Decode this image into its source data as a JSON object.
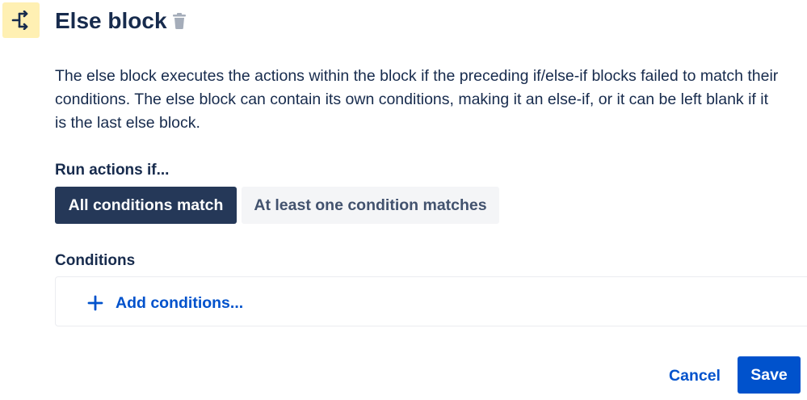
{
  "header": {
    "icon": "branch-icon",
    "title": "Else block",
    "delete_icon": "trash-icon"
  },
  "description": "The else block executes the actions within the block if the preceding if/else-if blocks failed to match their conditions. The else block can contain its own conditions, making it an else-if, or it can be left blank if it is the last else block.",
  "run_actions": {
    "label": "Run actions if...",
    "options": [
      {
        "label": "All conditions match",
        "selected": true
      },
      {
        "label": "At least one condition matches",
        "selected": false
      }
    ]
  },
  "conditions": {
    "label": "Conditions",
    "add_label": "Add conditions...",
    "add_icon": "plus-icon"
  },
  "footer": {
    "cancel_label": "Cancel",
    "save_label": "Save"
  },
  "colors": {
    "icon_bg": "#fff0b3",
    "text_primary": "#172b4d",
    "selected_bg": "#253858",
    "unselected_bg": "#f4f5f7",
    "link_blue": "#0052cc"
  }
}
